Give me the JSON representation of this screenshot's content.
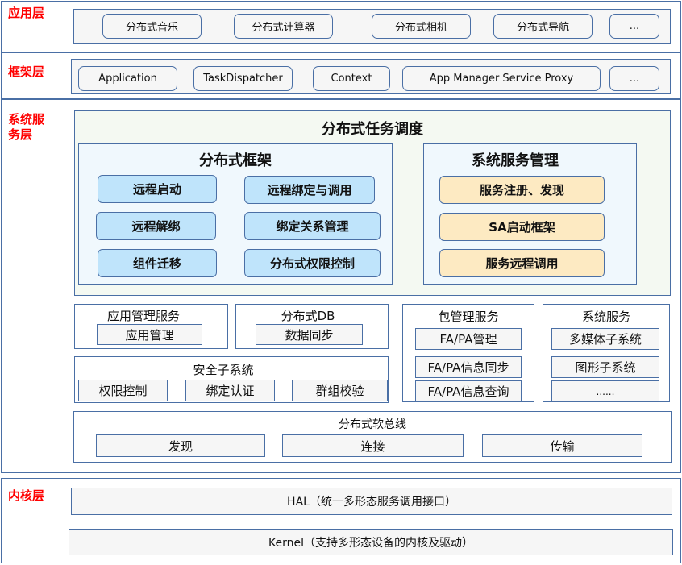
{
  "layers": {
    "app": {
      "label": "应用层",
      "items": [
        "分布式音乐",
        "分布式计算器",
        "分布式相机",
        "分布式导航",
        "..."
      ]
    },
    "framework": {
      "label": "框架层",
      "items": [
        "Application",
        "TaskDispatcher",
        "Context",
        "App Manager Service Proxy",
        "..."
      ]
    },
    "system_service": {
      "label_line1": "系统服",
      "label_line2": "务层",
      "scheduler": {
        "title": "分布式任务调度",
        "dist_framework": {
          "title": "分布式框架",
          "items": [
            "远程启动",
            "远程绑定与调用",
            "远程解绑",
            "绑定关系管理",
            "组件迁移",
            "分布式权限控制"
          ]
        },
        "sys_service_mgmt": {
          "title": "系统服务管理",
          "items": [
            "服务注册、发现",
            "SA启动框架",
            "服务远程调用"
          ]
        }
      },
      "app_mgmt_service": {
        "title": "应用管理服务",
        "items": [
          "应用管理"
        ]
      },
      "dist_db": {
        "title": "分布式DB",
        "items": [
          "数据同步"
        ]
      },
      "security": {
        "title": "安全子系统",
        "items": [
          "权限控制",
          "绑定认证",
          "群组校验"
        ]
      },
      "bundle_mgmt": {
        "title": "包管理服务",
        "items": [
          "FA/PA管理",
          "FA/PA信息同步",
          "FA/PA信息查询"
        ]
      },
      "system_services": {
        "title": "系统服务",
        "items": [
          "多媒体子系统",
          "图形子系统",
          "......"
        ]
      },
      "soft_bus": {
        "title": "分布式软总线",
        "items": [
          "发现",
          "连接",
          "传输"
        ]
      }
    },
    "kernel": {
      "label": "内核层",
      "hal": "HAL（统一多形态服务调用接口）",
      "kernel": "Kernel（支持多形态设备的内核及驱动）"
    }
  }
}
